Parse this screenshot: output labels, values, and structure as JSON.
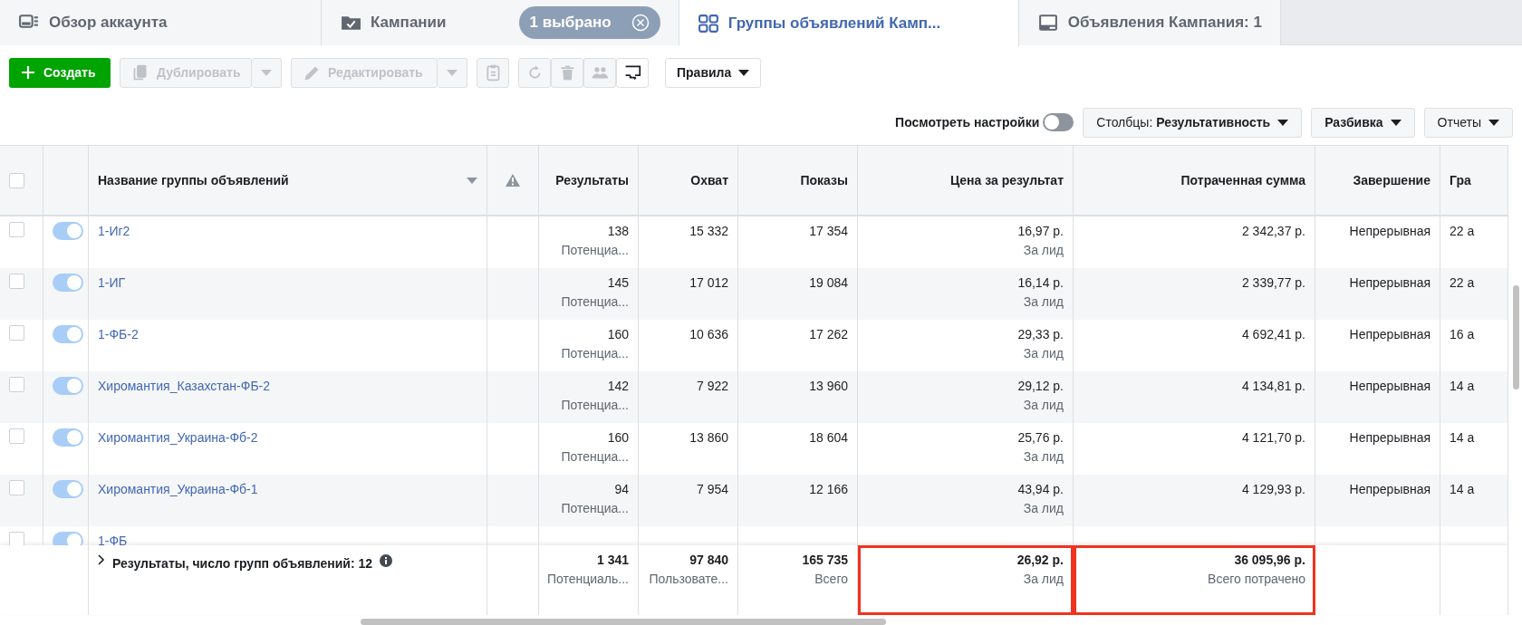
{
  "tabs": [
    {
      "label": "Обзор аккаунта",
      "selected": false
    },
    {
      "label": "Кампании",
      "selected": false,
      "chip": "1 выбрано"
    },
    {
      "label": "Группы объявлений Камп...",
      "selected": true
    },
    {
      "label": "Объявления Кампания: 1",
      "selected": false
    }
  ],
  "toolbar": {
    "create": "Создать",
    "split_buttons": [
      {
        "label": "Дублировать",
        "disabled": true
      },
      {
        "label": "Редактировать",
        "disabled": true
      }
    ],
    "icon_buttons": [
      {
        "disabled": true
      },
      {
        "disabled": true
      },
      {
        "disabled": true
      },
      {
        "disabled": true
      },
      {
        "disabled": false
      }
    ],
    "rules": "Правила"
  },
  "view_settings": {
    "label": "Посмотреть настройки",
    "on": false
  },
  "columns_button": {
    "prefix": "Столбцы:",
    "value": "Результативность"
  },
  "breakdown": "Разбивка",
  "reports": "Отчеты",
  "table": {
    "select_all": {
      "checked": false
    },
    "columns": [
      "Название группы объявлений",
      "Результаты",
      "Охват",
      "Показы",
      "Цена за результат",
      "Потраченная сумма",
      "Завершение",
      "Гра"
    ],
    "rows": [
      {
        "checked": false,
        "on": true,
        "name": "1-Иг2",
        "results": "138",
        "results_note": "Потенциа...",
        "reach": "15 332",
        "impressions": "17 354",
        "cost": "16,97 р.",
        "cost_note": "За лид",
        "spent": "2 342,37 р.",
        "end": "Непрерывная",
        "column_9": "22 а"
      },
      {
        "checked": false,
        "on": true,
        "name": "1-ИГ",
        "results": "145",
        "results_note": "Потенциа...",
        "reach": "17 012",
        "impressions": "19 084",
        "cost": "16,14 р.",
        "cost_note": "За лид",
        "spent": "2 339,77 р.",
        "end": "Непрерывная",
        "column_9": "22 а"
      },
      {
        "checked": false,
        "on": true,
        "name": "1-ФБ-2",
        "results": "160",
        "results_note": "Потенциа...",
        "reach": "10 636",
        "impressions": "17 262",
        "cost": "29,33 р.",
        "cost_note": "За лид",
        "spent": "4 692,41 р.",
        "end": "Непрерывная",
        "column_9": "16 а"
      },
      {
        "checked": false,
        "on": true,
        "name": "Хиромантия_Казахстан-ФБ-2",
        "results": "142",
        "results_note": "Потенциа...",
        "reach": "7 922",
        "impressions": "13 960",
        "cost": "29,12 р.",
        "cost_note": "За лид",
        "spent": "4 134,81 р.",
        "end": "Непрерывная",
        "column_9": "14 а"
      },
      {
        "checked": false,
        "on": true,
        "name": "Хиромантия_Украина-Фб-2",
        "results": "160",
        "results_note": "Потенциа...",
        "reach": "13 860",
        "impressions": "18 604",
        "cost": "25,76 р.",
        "cost_note": "За лид",
        "spent": "4 121,70 р.",
        "end": "Непрерывная",
        "column_9": "14 а"
      },
      {
        "checked": false,
        "on": true,
        "name": "Хиромантия_Украина-Фб-1",
        "results": "94",
        "results_note": "Потенциа...",
        "reach": "7 954",
        "impressions": "12 166",
        "cost": "43,94 р.",
        "cost_note": "За лид",
        "spent": "4 129,93 р.",
        "end": "Непрерывная",
        "column_9": "14 а"
      }
    ],
    "partial_row": {
      "checked": false,
      "on": true,
      "name": "1-ФБ"
    },
    "totals": {
      "label": "Результаты, число групп объявлений: 12",
      "results": "1 341",
      "results_note": "Потенциаль...",
      "reach": "97 840",
      "reach_note": "Пользовате...",
      "impressions": "165 735",
      "impressions_note": "Всего",
      "cost": "26,92 р.",
      "cost_note": "За лид",
      "cost_highlighted": true,
      "spent": "36 095,96 р.",
      "spent_note": "Всего потрачено",
      "spent_highlighted": true
    }
  }
}
